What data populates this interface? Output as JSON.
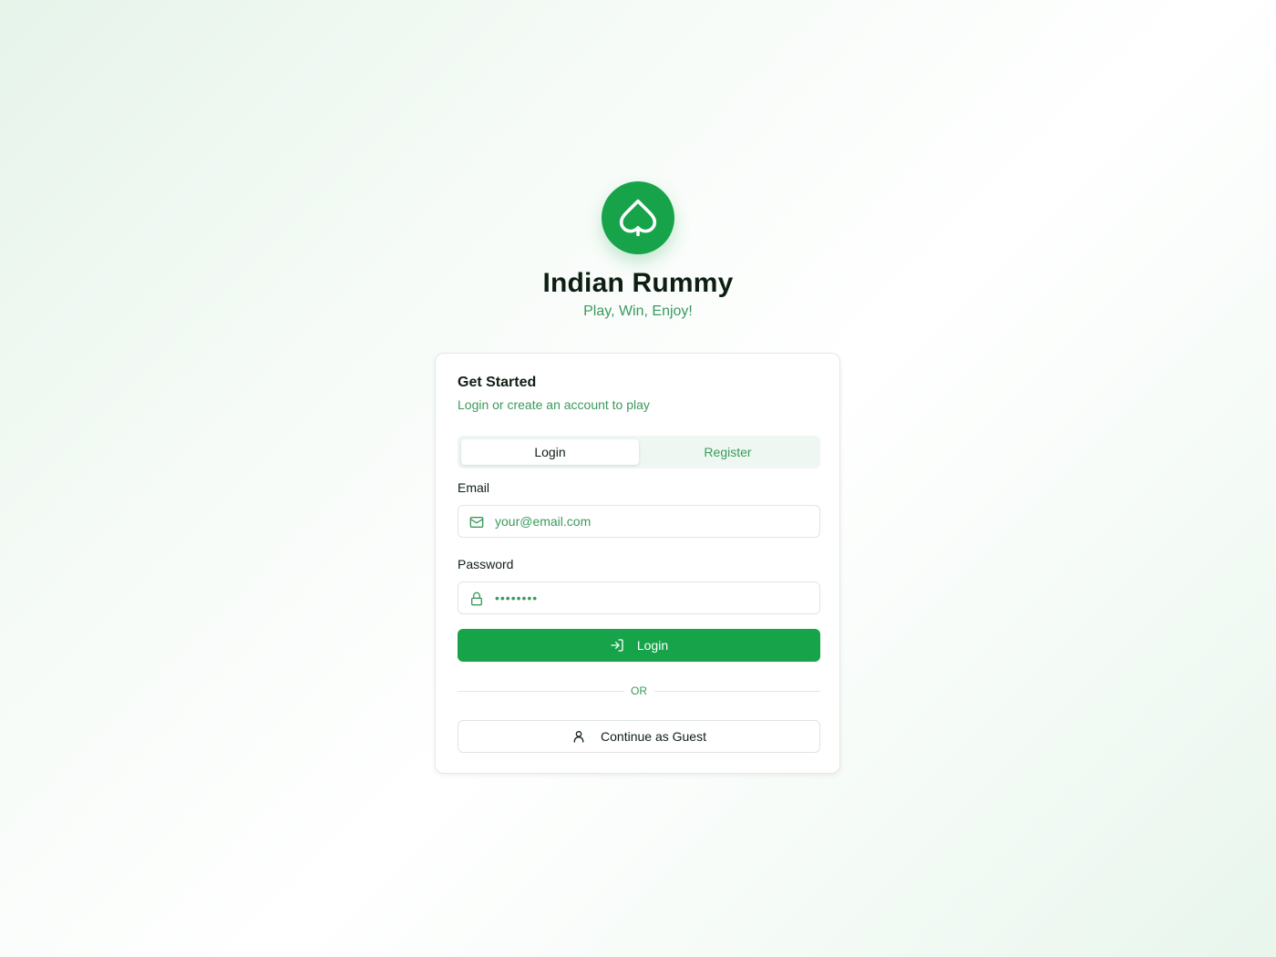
{
  "app": {
    "title": "Indian Rummy",
    "subtitle": "Play, Win, Enjoy!",
    "logo_icon": "spade-icon"
  },
  "card": {
    "title": "Get Started",
    "description": "Login or create an account to play"
  },
  "tabs": [
    {
      "label": "Login",
      "active": true
    },
    {
      "label": "Register",
      "active": false
    }
  ],
  "form": {
    "email_label": "Email",
    "email_placeholder": "your@email.com",
    "email_icon": "mail-icon",
    "password_label": "Password",
    "password_value": "••••••••",
    "password_icon": "lock-icon",
    "login_button": "Login",
    "login_icon": "log-in-icon",
    "divider_text": "OR",
    "guest_button": "Continue as Guest",
    "guest_icon": "user-icon"
  },
  "colors": {
    "brand": "#16a34a",
    "muted_text": "#3a9a5c",
    "tab_bg": "#eef7f1"
  }
}
